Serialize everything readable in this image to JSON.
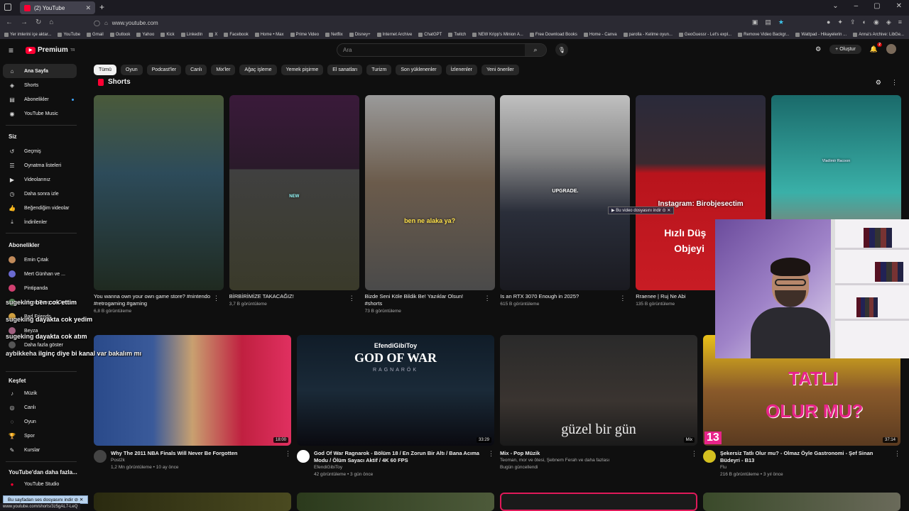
{
  "browser": {
    "tab_title": "(2) YouTube",
    "url": "www.youtube.com",
    "status_url": "www.youtube.com/shorts/3z5gAL7-LeQ",
    "bookmarks": [
      "Yer imlerini içe aktar...",
      "YouTube",
      "Gmail",
      "Outlook",
      "Yahoo",
      "Kick",
      "LinkedIn",
      "X",
      "Facebook",
      "Home • Max",
      "Prime Video",
      "Netflix",
      "Disney+",
      "Internet Archive",
      "ChatGPT",
      "Twitch",
      "NEW Kripp's Minion A...",
      "Free Download Books",
      "Home - Canva",
      "parolla - Kelime oyun...",
      "GeoGuessr - Let's expl...",
      "Remove Video Backgr...",
      "Wattpad - Hikayelerin ...",
      "Anna's Archive: LibGe..."
    ],
    "download_popup": "Bu video dosyasını indir",
    "download_bar": "Bu sayfadan ses dosyasını indir"
  },
  "header": {
    "logo": "Premium",
    "logo_region": "TR",
    "search_placeholder": "Ara",
    "create_label": "Oluştur",
    "notif_count": "2"
  },
  "sidebar": {
    "main": [
      {
        "label": "Ana Sayfa",
        "icon": "home-icon"
      },
      {
        "label": "Shorts",
        "icon": "shorts-icon"
      },
      {
        "label": "Abonelikler",
        "icon": "subscriptions-icon"
      },
      {
        "label": "YouTube Music",
        "icon": "music-icon"
      }
    ],
    "you_header": "Siz",
    "you": [
      {
        "label": "Geçmiş",
        "icon": "history-icon"
      },
      {
        "label": "Oynatma listeleri",
        "icon": "playlist-icon"
      },
      {
        "label": "Videolarınız",
        "icon": "video-icon"
      },
      {
        "label": "Daha sonra izle",
        "icon": "watch-later-icon"
      },
      {
        "label": "Beğendiğim videolar",
        "icon": "like-icon"
      },
      {
        "label": "İndirilenler",
        "icon": "download-icon"
      }
    ],
    "subs_header": "Abonelikler",
    "subs": [
      {
        "label": "Emin Çıtak",
        "color": "#c08a5a"
      },
      {
        "label": "Mert Günhan ve ...",
        "color": "#6a6ad0"
      },
      {
        "label": "Pintipanda",
        "color": "#d04070"
      },
      {
        "label": "Alican Tunç ve Oyu...",
        "color": "#5a8a5a"
      },
      {
        "label": "Bad Friends",
        "color": "#d0a040"
      },
      {
        "label": "Beyza",
        "color": "#a06080"
      },
      {
        "label": "Daha fazla göster",
        "color": "#555555"
      }
    ],
    "explore_header": "Keşfet",
    "explore": [
      {
        "label": "Müzik",
        "icon": "music-note-icon"
      },
      {
        "label": "Canlı",
        "icon": "live-icon"
      },
      {
        "label": "Oyun",
        "icon": "gaming-icon"
      },
      {
        "label": "Spor",
        "icon": "trophy-icon"
      },
      {
        "label": "Kurslar",
        "icon": "courses-icon"
      }
    ],
    "more_header": "YouTube'dan daha fazla...",
    "more": [
      {
        "label": "YouTube Studio",
        "icon": "studio-icon"
      }
    ]
  },
  "chips": [
    "Tümü",
    "Oyun",
    "Podcast'ler",
    "Canlı",
    "Mix'ler",
    "Ağaç işleme",
    "Yemek pişirme",
    "El sanatları",
    "Turizm",
    "Son yüklenenler",
    "İzlenenler",
    "Yeni öneriler"
  ],
  "shorts_title": "Shorts",
  "shorts": [
    {
      "title": "You wanna own your own game store? #nintendo #retrogaming #gaming",
      "views": "6,8 B görüntüleme"
    },
    {
      "title": "BİRBİRİMİZE TAKACAĞIZ!",
      "views": "3,7 B görüntüleme",
      "overlay": "NEW"
    },
    {
      "title": "Bizde Seni Köle Bildik Be! Yazıklar Olsun! #shorts",
      "views": "73 B görüntüleme",
      "overlay": "ben ne alaka ya?"
    },
    {
      "title": "Is an RTX 3070 Enough in 2025?",
      "views": "615 B görüntüleme",
      "overlay": "UPGRADE."
    },
    {
      "title": "Rraenee | Ruj Ne Abi",
      "views": "135 B görüntüleme",
      "overlay": "Instagram: Birobjesectim",
      "overlay2": "Hızlı Düş",
      "overlay3": "Objeyi"
    },
    {
      "title": "",
      "views": "",
      "overlay": "Vladimir Racoon"
    }
  ],
  "videos": [
    {
      "title": "Why The 2011 NBA Finals Will Never Be Forgotten",
      "channel": "Post2k",
      "meta": "1,2 Mn görüntüleme • 10 ay önce",
      "duration": "18:00",
      "thumb_text": "",
      "avatar": "#444444"
    },
    {
      "title": "God Of War Ragnarok - Bölüm 18 / En Zorun Bir Altı / Bana Acıma Modu / Ölüm Sayacı Aktif / 4K 60 FPS",
      "channel": "EfendiGibiToy",
      "meta": "42 görüntüleme • 3 gün önce",
      "duration": "33:29",
      "thumb_text": "EfendiGibiToy",
      "thumb_title": "GOD OF WAR",
      "thumb_sub": "RAGNARÖK",
      "avatar": "#ffffff"
    },
    {
      "title": "Mix - Pop Müzik",
      "channel": "Teoman, mor ve ötesi, Şebnem Ferah ve daha fazlası",
      "meta": "Bugün güncellendi",
      "duration": "Mix",
      "thumb_text": "güzel bir gün",
      "avatar": ""
    },
    {
      "title": "Şekersiz Tatlı Olur mu? - Olmaz Öyle Gastronomi - Şef Sinan Büdeyri - B13",
      "channel": "Flu",
      "meta": "216 B görüntüleme • 3 yıl önce",
      "duration": "37:14",
      "thumb_text": "TATLI",
      "thumb_text2": "OLUR MU?",
      "thumb_num": "13",
      "avatar": "#d4c020"
    }
  ],
  "chat": [
    {
      "user": "sugeking",
      "msg": "ben cok ettim"
    },
    {
      "user": "sugeking",
      "msg": "dayakta cok yedim"
    },
    {
      "user": "sugeking",
      "msg": "dayakta cok atım"
    },
    {
      "user": "aybikkeha",
      "msg": "ilginç diye bi kanal var bakalım mı"
    }
  ]
}
